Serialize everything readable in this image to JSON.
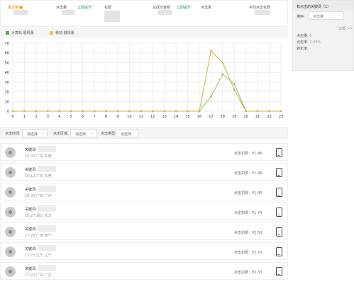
{
  "stats": [
    {
      "label": "展现量",
      "value": "",
      "orange": true,
      "help": true
    },
    {
      "label": "点击量",
      "value": "",
      "link": "立即提升"
    },
    {
      "label": "花费",
      "value": ""
    },
    {
      "label": "总成交金额",
      "value": "",
      "link": "立即提升"
    },
    {
      "label": "点击率",
      "value": "-"
    },
    {
      "label": "平均点击花费",
      "value": ""
    }
  ],
  "legend": [
    {
      "label": "计算机·展现量",
      "color": "#5aaa5a"
    },
    {
      "label": "移动·展现量",
      "color": "#f0c341"
    }
  ],
  "chart_data": {
    "type": "line",
    "x": [
      0,
      1,
      2,
      3,
      4,
      5,
      6,
      7,
      8,
      9,
      10,
      11,
      12,
      13,
      14,
      15,
      16,
      17,
      18,
      19,
      20,
      21,
      22,
      23
    ],
    "xticks": [
      "0",
      "1",
      "2",
      "3",
      "4",
      "5",
      "6",
      "7",
      "8",
      "9",
      "10",
      "11",
      "12",
      "13",
      "14",
      "15",
      "16",
      "17",
      "18",
      "19",
      "20",
      "21",
      "22",
      "23"
    ],
    "yticks": [
      "0",
      "10",
      "20",
      "30",
      "40",
      "50",
      "60",
      "70"
    ],
    "ylim": [
      0,
      70
    ],
    "grid": true,
    "series": [
      {
        "name": "计算机·展现量",
        "color": "#8bbf6b",
        "values": [
          0,
          0,
          0,
          0,
          0,
          0,
          0,
          0,
          0,
          0,
          0,
          0,
          0,
          0,
          0,
          0,
          0,
          15,
          38,
          28,
          0,
          0,
          0,
          0
        ]
      },
      {
        "name": "移动·展现量",
        "color": "#c8b638",
        "values": [
          0,
          0,
          0,
          0,
          0,
          0,
          0,
          0,
          0,
          0,
          0,
          0,
          0,
          0,
          0,
          0,
          0,
          62,
          50,
          22,
          0,
          0,
          0,
          0
        ]
      }
    ]
  },
  "filters": [
    {
      "label": "点击时间:",
      "value": "请选择"
    },
    {
      "label": "点击区域:",
      "value": "请选择"
    },
    {
      "label": "点击类型:",
      "value": "请选择"
    }
  ],
  "rows": [
    {
      "keyword_label": "关键词:",
      "meta": "10:33 广东 东莞",
      "price": "点击扣费：¥1.46"
    },
    {
      "keyword_label": "关键词:",
      "meta": "10:12 广东 东莞",
      "price": "点击扣费：¥1.46"
    },
    {
      "keyword_label": "关键词:",
      "meta": "18:35 广西 广州",
      "price": "点击扣费：¥1.06"
    },
    {
      "keyword_label": "关键词:",
      "meta": "18:27 湖北 武汉",
      "price": "点击扣费：¥1.74"
    },
    {
      "keyword_label": "关键词:",
      "meta": "17:28 广西 南宁",
      "price": "点击扣费：¥2.53"
    },
    {
      "keyword_label": "关键词:",
      "meta": "17:27 辽宁 辽宁",
      "price": "点击扣费：¥2.70"
    },
    {
      "keyword_label": "关键词:",
      "meta": "17:22 广东 广东",
      "price": "点击扣费：¥2.33"
    }
  ],
  "side": {
    "title": "有点击的关键词（1）",
    "sort_label": "排序:",
    "sort_value": "点击量",
    "more": "详细 >>",
    "keyword": "",
    "lines": [
      {
        "label": "点击量:",
        "value": "0"
      },
      {
        "label": "点击率:",
        "value": "7.39%"
      },
      {
        "label": "转化率:",
        "value": "-"
      }
    ]
  }
}
